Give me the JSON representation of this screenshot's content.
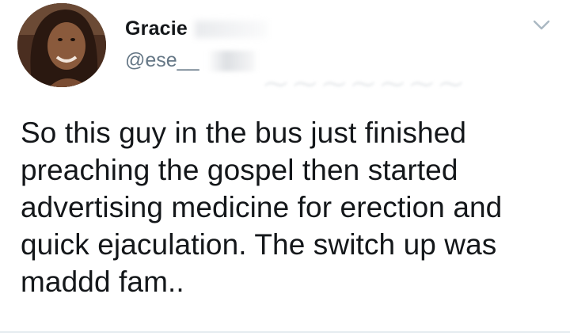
{
  "tweet": {
    "author": {
      "display_name": "Gracie",
      "handle": "@ese__",
      "avatar_icon": "profile-photo"
    },
    "text": "So this guy in the bus just finished preaching the gospel then started advertising medicine for erection and quick ejaculation. The switch up was maddd fam..",
    "menu_icon": "chevron-down-icon"
  },
  "colors": {
    "text_primary": "#14171a",
    "text_secondary": "#657786",
    "chevron": "#aab8c2"
  }
}
